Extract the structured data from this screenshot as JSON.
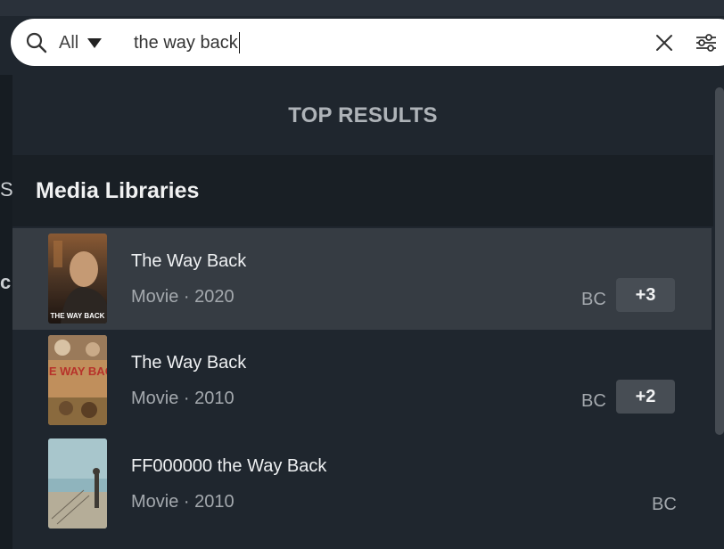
{
  "search": {
    "scope": "All",
    "query": "the way back"
  },
  "results": {
    "top_header": "TOP RESULTS",
    "section_title": "Media Libraries",
    "items": [
      {
        "title": "The Way Back",
        "meta": "Movie · 2020",
        "server": "BC",
        "count_badge": "+3",
        "poster_text": "THE WAY BACK",
        "selected": true
      },
      {
        "title": "The Way Back",
        "meta": "Movie · 2010",
        "server": "BC",
        "count_badge": "+2",
        "poster_text": "THE WAY BACK",
        "selected": false
      },
      {
        "title": "FF000000 the Way Back",
        "meta": "Movie · 2010",
        "server": "BC",
        "count_badge": "",
        "selected": false
      }
    ]
  },
  "background": {
    "left_glyph_1": "S",
    "left_glyph_2": "c"
  },
  "icons": {
    "search": "search-icon",
    "scope_dropdown": "caret-down-icon",
    "clear": "close-icon",
    "filter": "sliders-icon"
  },
  "colors": {
    "panel_bg": "#1f262e",
    "section_bg": "#191f25",
    "selected_row_bg": "#363c43",
    "badge_bg": "#474d54",
    "search_bg": "#ffffff"
  }
}
